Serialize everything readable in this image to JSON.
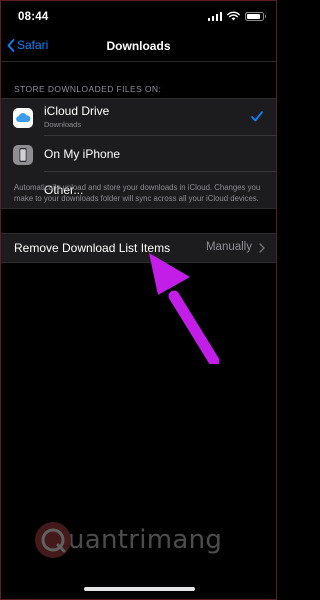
{
  "status_bar": {
    "time": "08:44",
    "battery_level": 0.85
  },
  "nav": {
    "back_label": "Safari",
    "title": "Downloads"
  },
  "storage_section": {
    "header": "STORE DOWNLOADED FILES ON:",
    "options": [
      {
        "label": "iCloud Drive",
        "sublabel": "Downloads",
        "icon": "icloud-drive-icon",
        "selected": true
      },
      {
        "label": "On My iPhone",
        "icon": "iphone-icon",
        "selected": false
      },
      {
        "label": "Other...",
        "selected": false
      }
    ],
    "footer": "Automatically upload and store your downloads in iCloud. Changes you make to your downloads folder will sync across all your iCloud devices."
  },
  "remove_items": {
    "label": "Remove Download List Items",
    "value": "Manually"
  },
  "annotation": {
    "color": "#c21ee8"
  },
  "watermark": {
    "text": "uantrimang"
  },
  "colors": {
    "accent": "#0a84ff",
    "background": "#000000",
    "cell_background": "#1c1c1e",
    "secondary_text": "#8d8d93"
  }
}
